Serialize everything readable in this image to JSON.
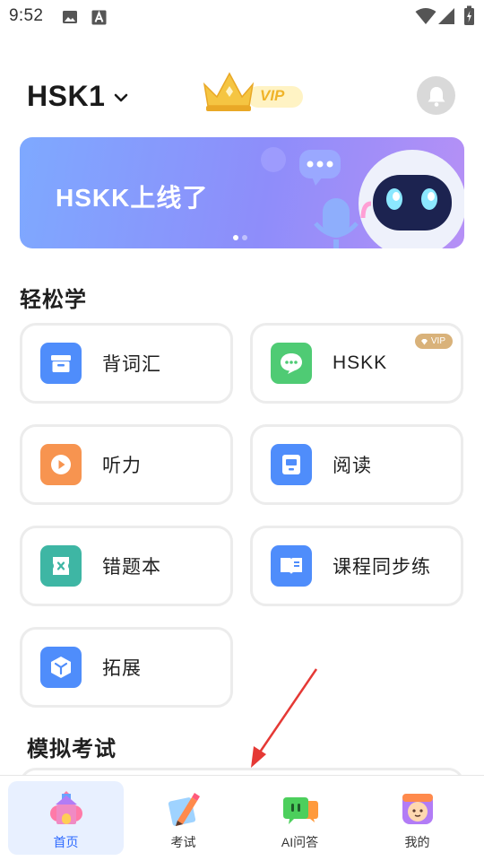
{
  "status_bar": {
    "time": "9:52",
    "icons": [
      "image-icon",
      "text-a-icon",
      "wifi-icon",
      "signal-icon",
      "battery-charging-icon"
    ]
  },
  "header": {
    "level_label": "HSK1",
    "vip_text": "VIP"
  },
  "banner": {
    "title": "HSKK上线了",
    "dots": 2,
    "active_dot": 0
  },
  "section_easy": {
    "title": "轻松学",
    "cards": [
      {
        "label": "背词汇",
        "icon": "vocab-box-icon",
        "color": "#4f8dfb"
      },
      {
        "label": "HSKK",
        "icon": "chat-bubble-icon",
        "color": "#4fcb74",
        "badge": "VIP"
      },
      {
        "label": "听力",
        "icon": "play-icon",
        "color": "#f79450"
      },
      {
        "label": "阅读",
        "icon": "reader-icon",
        "color": "#4f8dfb"
      },
      {
        "label": "错题本",
        "icon": "error-book-icon",
        "color": "#3eb6a4"
      },
      {
        "label": "课程同步练",
        "icon": "open-book-icon",
        "color": "#4f8dfb"
      },
      {
        "label": "拓展",
        "icon": "cube-icon",
        "color": "#4f8dfb"
      }
    ]
  },
  "section_exam": {
    "title": "模拟考试"
  },
  "bottom_nav": {
    "items": [
      {
        "label": "首页",
        "icon": "castle-home-icon",
        "active": true
      },
      {
        "label": "考试",
        "icon": "pencil-icon",
        "active": false
      },
      {
        "label": "AI问答",
        "icon": "ai-chat-icon",
        "active": false
      },
      {
        "label": "我的",
        "icon": "profile-avatar-icon",
        "active": false
      }
    ]
  },
  "colors": {
    "accent": "#2f6bff",
    "nav_active_bg": "#e8f0ff",
    "vip_gold": "#f5c542",
    "annotation_arrow": "#e53935"
  }
}
